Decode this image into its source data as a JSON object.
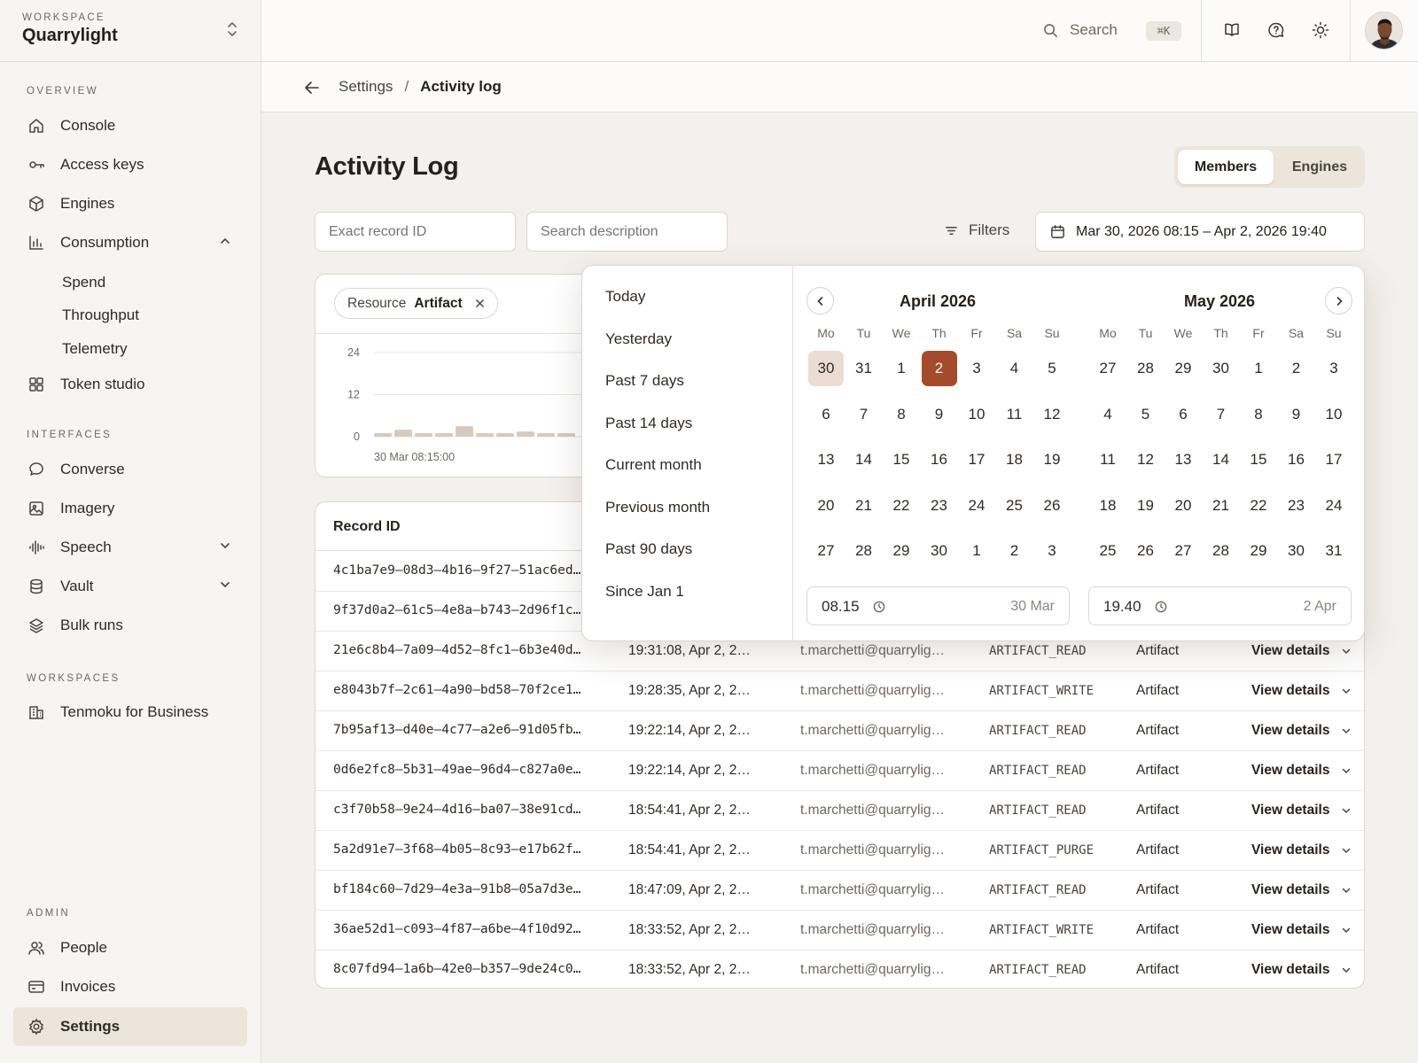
{
  "workspace": {
    "label": "WORKSPACE",
    "name": "Quarrylight"
  },
  "sections": {
    "overview": "OVERVIEW",
    "interfaces": "INTERFACES",
    "workspaces": "WORKSPACES",
    "admin": "ADMIN"
  },
  "nav": {
    "console": "Console",
    "access_keys": "Access keys",
    "engines": "Engines",
    "consumption": "Consumption",
    "spend": "Spend",
    "throughput": "Throughput",
    "telemetry": "Telemetry",
    "token_studio": "Token studio",
    "converse": "Converse",
    "imagery": "Imagery",
    "speech": "Speech",
    "vault": "Vault",
    "bulk_runs": "Bulk runs",
    "tenmoku": "Tenmoku for Business",
    "people": "People",
    "invoices": "Invoices",
    "settings": "Settings"
  },
  "topbar": {
    "search_label": "Search",
    "shortcut": "⌘K",
    "icons": [
      "book-icon",
      "help-bubble-icon",
      "sun-icon"
    ]
  },
  "breadcrumb": {
    "parent": "Settings",
    "separator": "/",
    "current": "Activity log"
  },
  "page": {
    "title": "Activity Log"
  },
  "tabs": {
    "members": "Members",
    "engines": "Engines",
    "selected": "Members"
  },
  "filters": {
    "record_id_placeholder": "Exact record ID",
    "description_placeholder": "Search description",
    "filters_label": "Filters",
    "date_range": "Mar 30, 2026 08:15 – Apr 2, 2026 19:40",
    "chip_key": "Resource",
    "chip_value": "Artifact"
  },
  "chart_data": {
    "type": "bar",
    "yticks": [
      "24",
      "12",
      "0"
    ],
    "ylim": [
      0,
      24
    ],
    "x_first_label": "30 Mar 08:15:00",
    "values": [
      1,
      2,
      1,
      1,
      3,
      1,
      1,
      1.5,
      1,
      1
    ]
  },
  "table": {
    "headers": {
      "record_id": "Record ID"
    },
    "rows": [
      {
        "id": "4c1ba7e9–08d3–4b16–9f27–51ac6ed…",
        "time": "",
        "user": "",
        "action": "",
        "resource": "",
        "details": ""
      },
      {
        "id": "9f37d0a2–61c5–4e8a–b743–2d96f1c…",
        "time": "",
        "user": "",
        "action": "",
        "resource": "",
        "details": ""
      },
      {
        "id": "21e6c8b4–7a09–4d52–8fc1–6b3e40d…",
        "time": "19:31:08, Apr 2, 2…",
        "user": "t.marchetti@quarrylig…",
        "action": "ARTIFACT_READ",
        "resource": "Artifact",
        "details": "View details"
      },
      {
        "id": "e8043b7f–2c61–4a90–bd58–70f2ce1…",
        "time": "19:28:35, Apr 2, 2…",
        "user": "t.marchetti@quarrylig…",
        "action": "ARTIFACT_WRITE",
        "resource": "Artifact",
        "details": "View details"
      },
      {
        "id": "7b95af13–d40e–4c77–a2e6–91d05fb…",
        "time": "19:22:14, Apr 2, 2…",
        "user": "t.marchetti@quarrylig…",
        "action": "ARTIFACT_READ",
        "resource": "Artifact",
        "details": "View details"
      },
      {
        "id": "0d6e2fc8–5b31–49ae–96d4–c827a0e…",
        "time": "19:22:14, Apr 2, 2…",
        "user": "t.marchetti@quarrylig…",
        "action": "ARTIFACT_READ",
        "resource": "Artifact",
        "details": "View details"
      },
      {
        "id": "c3f70b58–9e24–4d16–ba07–38e91cd…",
        "time": "18:54:41, Apr 2, 2…",
        "user": "t.marchetti@quarrylig…",
        "action": "ARTIFACT_READ",
        "resource": "Artifact",
        "details": "View details"
      },
      {
        "id": "5a2d91e7–3f68–4b05–8c93–e17b62f…",
        "time": "18:54:41, Apr 2, 2…",
        "user": "t.marchetti@quarrylig…",
        "action": "ARTIFACT_PURGE",
        "resource": "Artifact",
        "details": "View details"
      },
      {
        "id": "bf184c60–7d29–4e3a–91b8–05a7d3e…",
        "time": "18:47:09, Apr 2, 2…",
        "user": "t.marchetti@quarrylig…",
        "action": "ARTIFACT_READ",
        "resource": "Artifact",
        "details": "View details"
      },
      {
        "id": "36ae52d1–c093–4f87–a6be–4f10d92…",
        "time": "18:33:52, Apr 2, 2…",
        "user": "t.marchetti@quarrylig…",
        "action": "ARTIFACT_WRITE",
        "resource": "Artifact",
        "details": "View details"
      },
      {
        "id": "8c07fd94–1a6b–42e0–b357–9de24c0…",
        "time": "18:33:52, Apr 2, 2…",
        "user": "t.marchetti@quarrylig…",
        "action": "ARTIFACT_READ",
        "resource": "Artifact",
        "details": "View details"
      }
    ]
  },
  "datepicker": {
    "presets": [
      "Today",
      "Yesterday",
      "Past 7 days",
      "Past 14 days",
      "Current month",
      "Previous month",
      "Past 90 days",
      "Since Jan 1"
    ],
    "weekdays": [
      "Mo",
      "Tu",
      "We",
      "Th",
      "Fr",
      "Sa",
      "Su"
    ],
    "months": [
      {
        "title": "April 2026",
        "days": [
          "30",
          "31",
          "1",
          "2",
          "3",
          "4",
          "5",
          "6",
          "7",
          "8",
          "9",
          "10",
          "11",
          "12",
          "13",
          "14",
          "15",
          "16",
          "17",
          "18",
          "19",
          "20",
          "21",
          "22",
          "23",
          "24",
          "25",
          "26",
          "27",
          "28",
          "29",
          "30",
          "1",
          "2",
          "3"
        ],
        "range_start_index": 0,
        "range_end_index": 3
      },
      {
        "title": "May 2026",
        "days": [
          "27",
          "28",
          "29",
          "30",
          "1",
          "2",
          "3",
          "4",
          "5",
          "6",
          "7",
          "8",
          "9",
          "10",
          "11",
          "12",
          "13",
          "14",
          "15",
          "16",
          "17",
          "18",
          "19",
          "20",
          "21",
          "22",
          "23",
          "24",
          "25",
          "26",
          "27",
          "28",
          "29",
          "30",
          "31"
        ]
      }
    ],
    "start_time": "08.15",
    "start_date": "30 Mar",
    "end_time": "19.40",
    "end_date": "2 Apr"
  },
  "colors": {
    "accent": "#a54a2a",
    "range_start": "#ebddd4",
    "bar": "#d9c9bd",
    "active_nav": "#ebe5da"
  }
}
